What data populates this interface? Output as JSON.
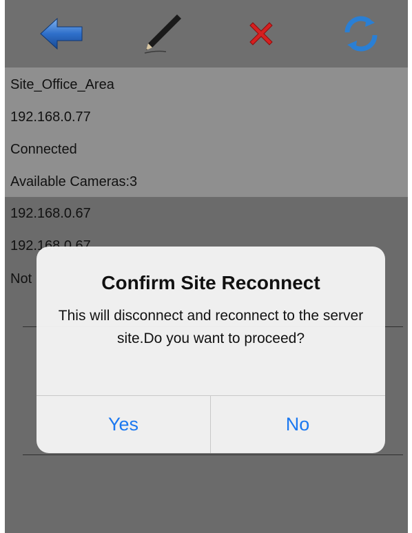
{
  "toolbar": {
    "icons": [
      "back-arrow-icon",
      "pencil-icon",
      "close-x-icon",
      "refresh-icon"
    ],
    "colors": {
      "back": "#1f5fb8",
      "delete": "#d62020",
      "refresh": "#2a7fd4"
    }
  },
  "site_selected": {
    "name": "Site_Office_Area",
    "ip": "192.168.0.77",
    "status": "Connected",
    "cameras": "Available Cameras:3"
  },
  "site_second": {
    "ip1": "192.168.0.67",
    "ip2": "192.168.0.67",
    "status": "Not"
  },
  "dialog": {
    "title": "Confirm Site Reconnect",
    "message": "This will disconnect and reconnect to the server site.Do you want to proceed?",
    "yes_label": "Yes",
    "no_label": "No",
    "button_color": "#1b78f0"
  }
}
